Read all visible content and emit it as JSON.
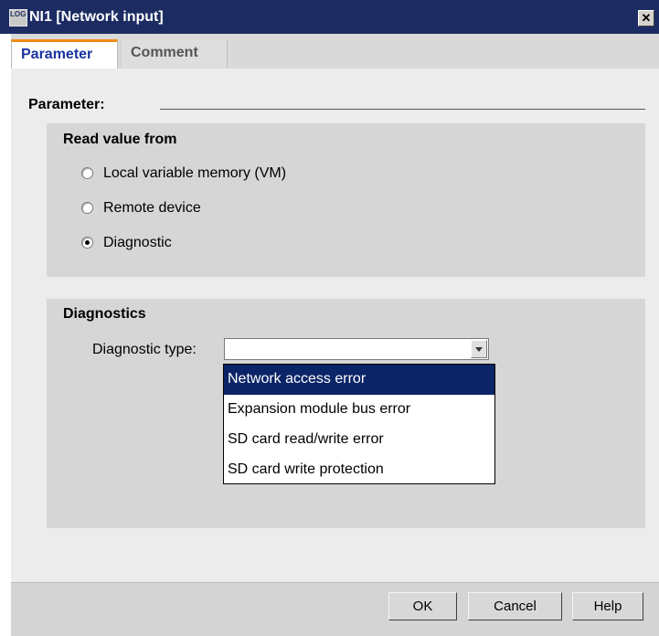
{
  "window": {
    "title": "NI1 [Network input]",
    "icon_text": "LOGO!",
    "close_glyph": "✕"
  },
  "tabs": [
    {
      "label": "Parameter",
      "active": true
    },
    {
      "label": "Comment",
      "active": false
    }
  ],
  "parameter_section": {
    "label": "Parameter:"
  },
  "read_value": {
    "title": "Read value from",
    "options": [
      {
        "label": "Local variable memory (VM)",
        "checked": false
      },
      {
        "label": "Remote device",
        "checked": false
      },
      {
        "label": "Diagnostic",
        "checked": true
      }
    ]
  },
  "diagnostics": {
    "title": "Diagnostics",
    "type_label": "Diagnostic type:",
    "type_value": "",
    "options": [
      {
        "label": "Network access error",
        "highlighted": true
      },
      {
        "label": "Expansion module bus error",
        "highlighted": false
      },
      {
        "label": "SD card read/write error",
        "highlighted": false
      },
      {
        "label": "SD card write protection",
        "highlighted": false
      }
    ]
  },
  "buttons": {
    "ok": "OK",
    "cancel": "Cancel",
    "help": "Help"
  },
  "colors": {
    "titlebar": "#1c2c63",
    "tab_accent": "#f28a16",
    "active_tab_text": "#1a33a0",
    "selection": "#0b2468"
  }
}
